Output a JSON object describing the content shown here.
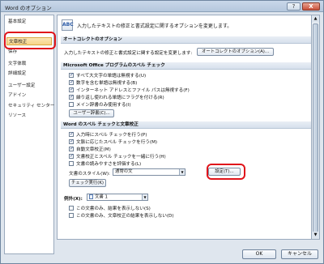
{
  "window": {
    "title": "Word のオプション",
    "help": "?",
    "close": "X"
  },
  "sidebar": {
    "items": [
      {
        "label": "基本設定",
        "selected": false
      },
      {
        "label": "文章校正",
        "selected": true
      },
      {
        "label": "保存",
        "selected": false
      },
      {
        "label": "文字体裁",
        "selected": false
      },
      {
        "label": "詳細設定",
        "selected": false
      },
      {
        "label": "ユーザー設定",
        "selected": false
      },
      {
        "label": "アドイン",
        "selected": false
      },
      {
        "label": "セキュリティ センター",
        "selected": false
      },
      {
        "label": "リソース",
        "selected": false
      }
    ]
  },
  "content": {
    "header_icon": "ABC",
    "header_text": "入力したテキストの修正と書式設定に関するオプションを変更します。",
    "autocorrect": {
      "heading": "オートコレクトのオプション",
      "description": "入力したテキストの修正と書式設定に関する設定を変更します:",
      "button": "オートコレクトのオプション(A)..."
    },
    "office_spell": {
      "heading": "Microsoft Office プログラムのスペル チェック",
      "options": [
        {
          "label": "すべて大文字の単語は無視する(U)",
          "checked": true
        },
        {
          "label": "数字を含む単語は無視する(B)",
          "checked": true
        },
        {
          "label": "インターネット アドレスとファイル パスは無視する(F)",
          "checked": true
        },
        {
          "label": "繰り返し使われる単語にフラグを付ける(R)",
          "checked": true
        },
        {
          "label": "メイン辞書のみ使用する(I)",
          "checked": false
        }
      ],
      "dictionary_button": "ユーザー辞書(C)..."
    },
    "word_spell": {
      "heading": "Word のスペル チェックと文章校正",
      "options": [
        {
          "label": "入力時にスペル チェックを行う(P)",
          "checked": true
        },
        {
          "label": "文脈に応じたスペル チェックを行う(M)",
          "checked": true
        },
        {
          "label": "自動文章校正(M)",
          "checked": true
        },
        {
          "label": "文書校正とスペル チェックを一緒に行う(H)",
          "checked": true
        },
        {
          "label": "文書の読みやすさを評価する(L)",
          "checked": false
        }
      ],
      "style_label": "文書のスタイル(W):",
      "style_value": "通常の文",
      "settings_button": "設定(T)...",
      "check_button": "チェック実行(K)"
    },
    "exceptions": {
      "heading": "例外(X):",
      "doc_value": "文書 1",
      "options": [
        {
          "label": "この文書のみ、結果を表示しない(S)",
          "checked": false
        },
        {
          "label": "この文書のみ、文章校正の結果を表示しない(D)",
          "checked": false
        }
      ]
    }
  },
  "footer": {
    "ok": "OK",
    "cancel": "キャンセル"
  },
  "annotation_color": "#e0141b"
}
